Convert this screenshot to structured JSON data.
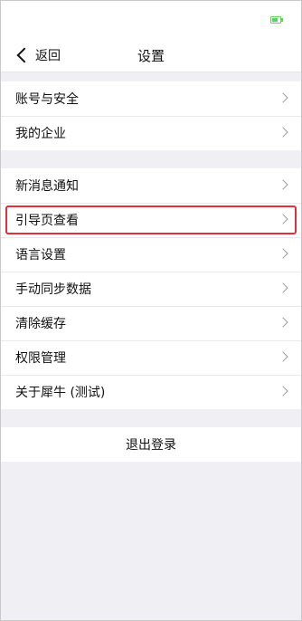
{
  "nav": {
    "back_label": "返回",
    "title": "设置"
  },
  "groups": [
    {
      "items": [
        {
          "label": "账号与安全"
        },
        {
          "label": "我的企业"
        }
      ]
    },
    {
      "items": [
        {
          "label": "新消息通知"
        },
        {
          "label": "引导页查看",
          "highlighted": true
        },
        {
          "label": "语言设置"
        },
        {
          "label": "手动同步数据"
        },
        {
          "label": "清除缓存"
        },
        {
          "label": "权限管理"
        },
        {
          "label": "关于犀牛 (测试)"
        }
      ]
    }
  ],
  "logout": {
    "label": "退出登录"
  },
  "colors": {
    "background": "#f0eff4",
    "highlight": "#e0303a",
    "battery": "#4cd964"
  }
}
